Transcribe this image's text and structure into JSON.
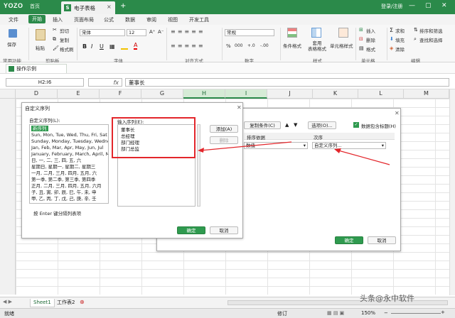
{
  "app": {
    "brand": "YOZO",
    "home_tab": "首页",
    "doc_tab": "电子表格",
    "doc_icon": "S",
    "login": "登录/注册"
  },
  "menu": [
    "文件",
    "开始",
    "插入",
    "页面布局",
    "公式",
    "数据",
    "审阅",
    "视图",
    "开发工具"
  ],
  "ribbon": {
    "save": "保存",
    "cut": "剪切",
    "copy": "复制",
    "paste": "粘贴",
    "format_painter": "格式刷",
    "font": "宋体",
    "font_size": "12",
    "number_format": "常规",
    "bold": "B",
    "italic": "I",
    "underline": "U",
    "percent": "%",
    "thousands": "000",
    "decimals_inc": "+.0",
    "decimals_dec": "-.00",
    "conditional_format": "条件格式",
    "table_style": "套用\n表格格式",
    "cell_style": "单元格样式",
    "insert": "插入",
    "delete": "删除",
    "format": "格式",
    "sum": "求和",
    "fill": "填充",
    "clear": "清除",
    "sort_filter": "排序和筛选",
    "find_select": "查找和选择",
    "groups": {
      "common": "常用功能",
      "clipboard": "剪贴板",
      "font": "字体",
      "alignment": "对齐方式",
      "number": "数字",
      "style": "样式",
      "cells": "单元格",
      "edit": "编辑"
    }
  },
  "sheet_tab_top": "操作示例",
  "formula_bar": {
    "name_box": "H2:I6",
    "fx": "fx",
    "content": "董事长"
  },
  "columns": [
    "D",
    "E",
    "F",
    "G",
    "H",
    "I",
    "J",
    "K",
    "L",
    "M"
  ],
  "selected_columns": [
    "H",
    "I"
  ],
  "sort_dialog": {
    "buttons": {
      "copy_condition": "复制条件(C)",
      "options": "选项(O)...",
      "ok": "确定",
      "cancel": "取消"
    },
    "header_checkbox": "数据包含标题(H)",
    "headers": {
      "sort_by": "排序依据",
      "order": "次序"
    },
    "row": {
      "sort_by_value": "数值",
      "order_value": "自定义序列..."
    }
  },
  "custom_list_dialog": {
    "title": "自定义序列",
    "list_label": "自定义序列(L):",
    "input_label": "输入序列(E):",
    "lists": [
      "新序列",
      "Sun, Mon, Tue, Wed, Thu, Fri, Sat",
      "Sunday, Monday, Tuesday, Wedne",
      "Jan, Feb, Mar, Apr, May, Jun, Jul",
      "January, February, March, April, M",
      "日, 一, 二, 三, 四, 五, 六",
      "星期日, 星期一, 星期二, 星期三",
      "一月, 二月, 三月, 四月, 五月, 六",
      "第一季, 第二季, 第三季, 第四季",
      "正月, 二月, 三月, 四月, 五月, 六月",
      "子, 丑, 寅, 卯, 辰, 巳, 午, 未, 申",
      "甲, 乙, 丙, 丁, 戊, 己, 庚, 辛, 壬"
    ],
    "entries": [
      "董事长",
      "总经理",
      "部门经理",
      "部门总监"
    ],
    "add": "添加(A)",
    "delete": "删除",
    "hint": "按 Enter 键分隔列表项",
    "ok": "确定",
    "cancel": "取消"
  },
  "sheets": [
    "Sheet1",
    "工作表2"
  ],
  "status": {
    "left": "就绪",
    "mode": "修订",
    "zoom": "150%"
  },
  "watermark": "头条@永中软件",
  "colors": {
    "accent": "#2b8a4a",
    "highlight": "#e3262b"
  }
}
